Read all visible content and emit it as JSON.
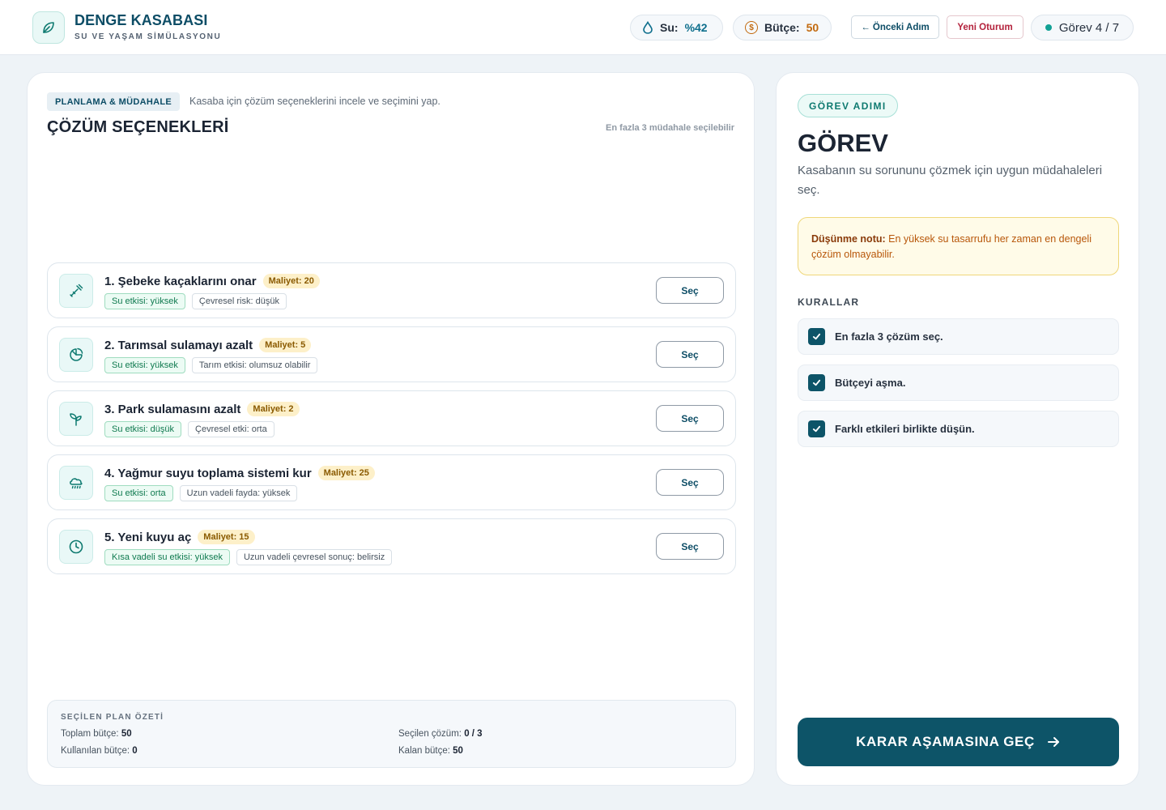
{
  "header": {
    "title": "DENGE KASABASI",
    "subtitle": "SU VE YAŞAM SİMÜLASYONU",
    "water_label": "Su:",
    "water_value": "%42",
    "budget_label": "Bütçe:",
    "budget_value": "50",
    "prev_button": "← Önceki Adım",
    "new_session_button": "Yeni Oturum",
    "task_progress": "Görev 4 / 7",
    "icons": {
      "logo": "leaf-icon",
      "water": "water-drop-icon",
      "budget": "coin-icon"
    }
  },
  "left": {
    "phase_badge": "PLANLAMA & MÜDAHALE",
    "phase_desc": "Kasaba için çözüm seçeneklerini incele ve seçimini yap.",
    "title": "ÇÖZÜM SEÇENEKLERİ",
    "limit_note": "En fazla 3 müdahale seçilebilir",
    "options": [
      {
        "name": "1. Şebeke kaçaklarını onar",
        "cost": "Maliyet: 20",
        "tag1": "Su etkisi: yüksek",
        "tag2": "Çevresel risk: düşük",
        "button": "Seç",
        "icon": "wrench-icon"
      },
      {
        "name": "2. Tarımsal sulamayı azalt",
        "cost": "Maliyet: 5",
        "tag1": "Su etkisi: yüksek",
        "tag2": "Tarım etkisi: olumsuz olabilir",
        "button": "Seç",
        "icon": "pie-chart-icon"
      },
      {
        "name": "3. Park sulamasını azalt",
        "cost": "Maliyet: 2",
        "tag1": "Su etkisi: düşük",
        "tag2": "Çevresel etki: orta",
        "button": "Seç",
        "icon": "sprout-icon"
      },
      {
        "name": "4. Yağmur suyu toplama sistemi kur",
        "cost": "Maliyet: 25",
        "tag1": "Su etkisi: orta",
        "tag2": "Uzun vadeli fayda: yüksek",
        "button": "Seç",
        "icon": "cloud-rain-icon"
      },
      {
        "name": "5. Yeni kuyu aç",
        "cost": "Maliyet: 15",
        "tag1": "Kısa vadeli su etkisi: yüksek",
        "tag2": "Uzun vadeli çevresel sonuç: belirsiz",
        "button": "Seç",
        "icon": "clock-icon"
      }
    ],
    "summary": {
      "title": "SEÇİLEN PLAN ÖZETİ",
      "total_label": "Toplam bütçe:",
      "total_value": "50",
      "used_label": "Kullanılan bütçe:",
      "used_value": "0",
      "selected_label": "Seçilen çözüm:",
      "selected_value": "0 / 3",
      "remaining_label": "Kalan bütçe:",
      "remaining_value": "50"
    }
  },
  "right": {
    "step_badge": "GÖREV ADIMI",
    "title": "GÖREV",
    "description": "Kasabanın su sorununu çözmek için uygun müdahaleleri seç.",
    "note_label": "Düşünme notu:",
    "note_text": " En yüksek su tasarrufu her zaman en dengeli çözüm olmayabilir.",
    "rules_title": "KURALLAR",
    "rules": [
      {
        "text": "En fazla 3 çözüm seç.",
        "checked": true
      },
      {
        "text": "Bütçeyi aşma.",
        "checked": true
      },
      {
        "text": "Farklı etkileri birlikte düşün.",
        "checked": true
      }
    ],
    "cta": "KARAR AŞAMASINA GEÇ"
  },
  "colors": {
    "primary": "#0d5468",
    "accent_teal": "#12a195",
    "cost_bg": "#fdf0c9",
    "note_bg": "#fffbe8",
    "danger": "#b3213b"
  }
}
